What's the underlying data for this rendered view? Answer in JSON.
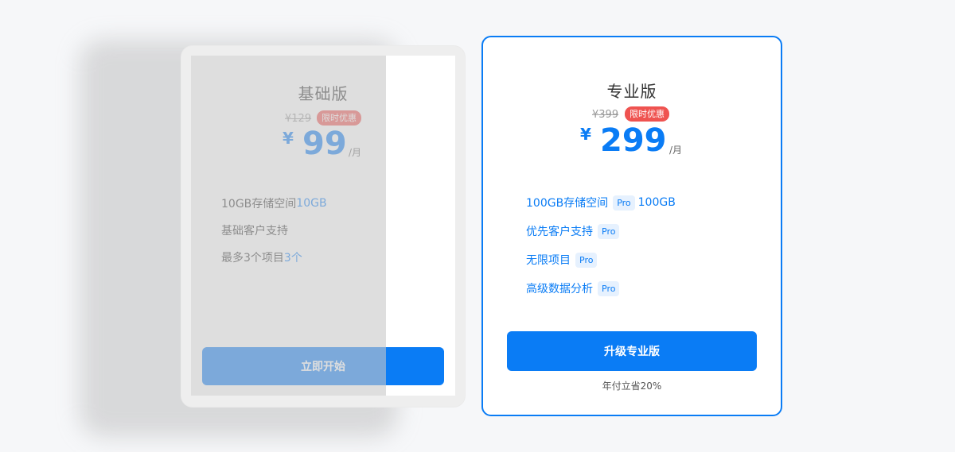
{
  "basic": {
    "title": "基础版",
    "old_price": "¥129",
    "badge": "限时优惠",
    "currency": "¥",
    "price": "99",
    "unit": "/月",
    "features": [
      {
        "text": "10GB存储空间",
        "highlight": "10GB"
      },
      {
        "text": "基础客户支持",
        "highlight": ""
      },
      {
        "text": "最多3个项目",
        "highlight": "3个"
      }
    ],
    "button": "立即开始"
  },
  "pro": {
    "title": "专业版",
    "old_price": "¥399",
    "badge": "限时优惠",
    "currency": "¥",
    "price": "299",
    "unit": "/月",
    "features": [
      {
        "text": "100GB存储空间",
        "tag": "Pro",
        "suffix": "100GB"
      },
      {
        "text": "优先客户支持",
        "tag": "Pro",
        "suffix": ""
      },
      {
        "text": "无限项目",
        "tag": "Pro",
        "suffix": ""
      },
      {
        "text": "高级数据分析",
        "tag": "Pro",
        "suffix": ""
      }
    ],
    "button": "升级专业版",
    "note": "年付立省20%"
  },
  "colors": {
    "accent": "#0a7cf5",
    "badge": "#ef5350"
  }
}
